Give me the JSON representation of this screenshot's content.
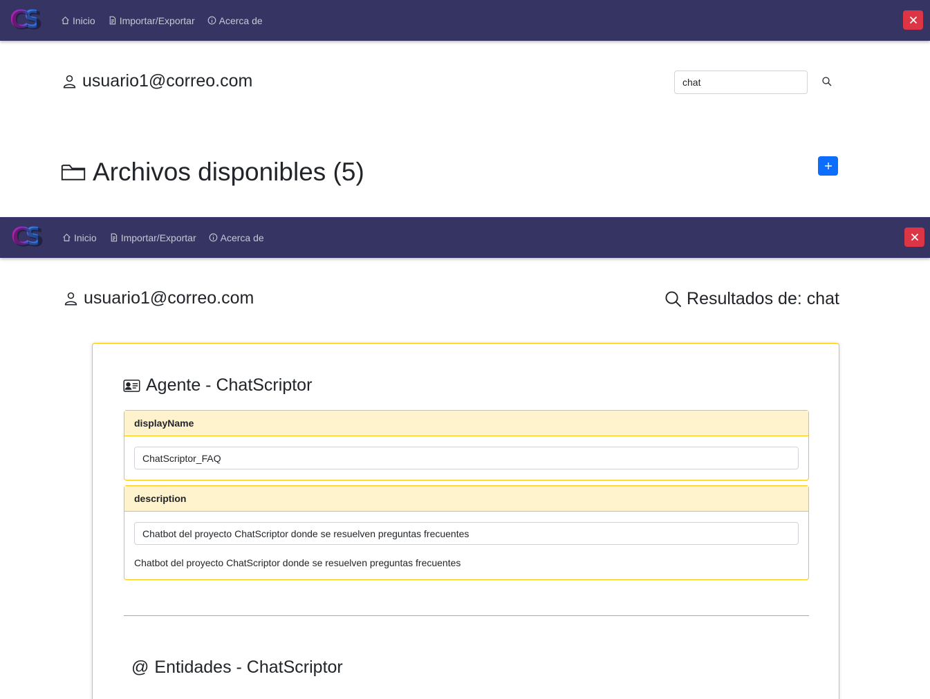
{
  "app": {
    "logo_text": "CS",
    "nav": [
      {
        "label": "Inicio",
        "icon": "home-icon"
      },
      {
        "label": "Importar/Exportar",
        "icon": "file-icon"
      },
      {
        "label": "Acerca de",
        "icon": "info-icon"
      }
    ],
    "close_icon": "close-icon"
  },
  "screen1": {
    "user_email": "usuario1@correo.com",
    "search": {
      "value": "chat"
    },
    "files_title": "Archivos disponibles (5)"
  },
  "screen2": {
    "user_email": "usuario1@correo.com",
    "results_title": "Resultados de: chat",
    "agent_section": {
      "title": "Agente - ChatScriptor",
      "fields": [
        {
          "label": "displayName",
          "value": "ChatScriptor_FAQ"
        },
        {
          "label": "description",
          "value": "Chatbot del proyecto ChatScriptor donde se resuelven preguntas frecuentes",
          "text": "Chatbot del proyecto ChatScriptor donde se resuelven preguntas frecuentes"
        }
      ]
    },
    "entities_section": {
      "title": "Entidades - ChatScriptor",
      "icon_glyph": "@"
    }
  },
  "colors": {
    "navbar": "#363463",
    "danger": "#dc3545",
    "primary": "#0d6efd",
    "warning_border": "#ffc107",
    "warning_bg": "#fff3cd"
  }
}
